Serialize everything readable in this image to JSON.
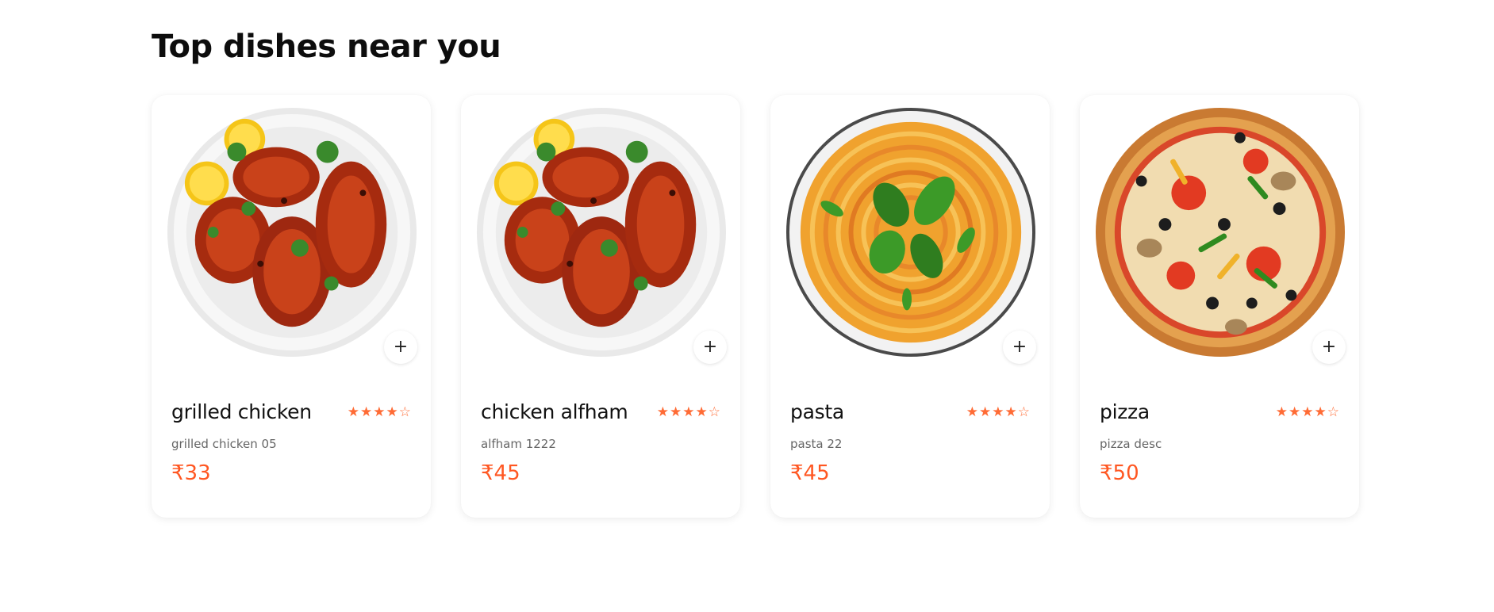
{
  "section": {
    "title": "Top dishes near you"
  },
  "colors": {
    "accent": "#ff5722",
    "star": "#ff6b35"
  },
  "dishes": [
    {
      "name": "grilled chicken",
      "description": "grilled chicken 05",
      "price": "₹33",
      "rating": 4,
      "rating_max": 5,
      "image_icon": "grilled-chicken-image",
      "add_label": "+"
    },
    {
      "name": "chicken alfham",
      "description": "alfham 1222",
      "price": "₹45",
      "rating": 4,
      "rating_max": 5,
      "image_icon": "chicken-alfham-image",
      "add_label": "+"
    },
    {
      "name": "pasta",
      "description": "pasta 22",
      "price": "₹45",
      "rating": 4,
      "rating_max": 5,
      "image_icon": "pasta-image",
      "add_label": "+"
    },
    {
      "name": "pizza",
      "description": "pizza desc",
      "price": "₹50",
      "rating": 4,
      "rating_max": 5,
      "image_icon": "pizza-image",
      "add_label": "+"
    }
  ]
}
